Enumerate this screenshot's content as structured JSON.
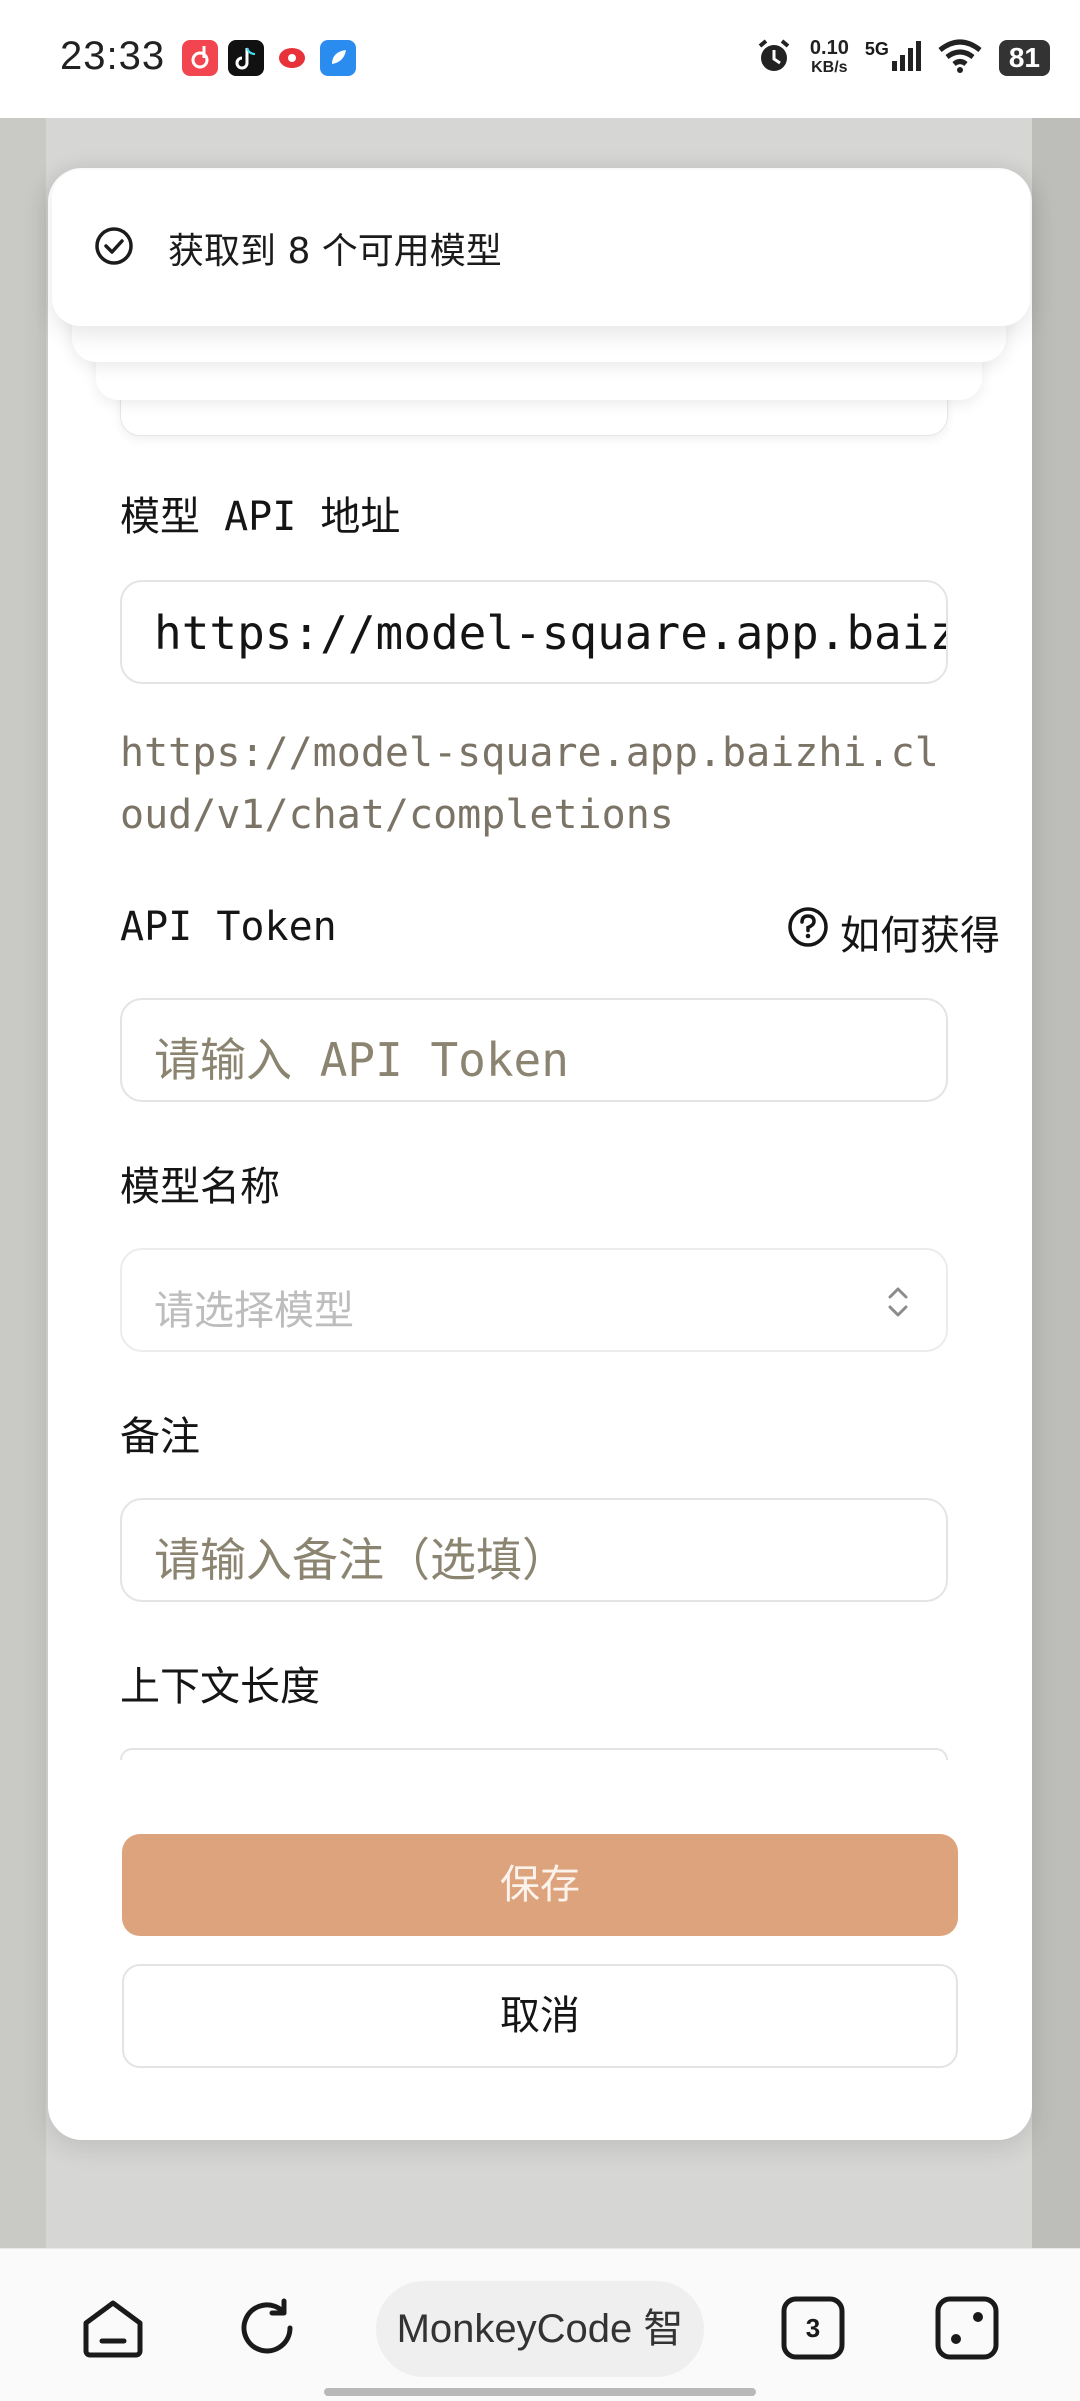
{
  "status_bar": {
    "time": "23:33",
    "net_speed_value": "0.10",
    "net_speed_unit": "KB/s",
    "signal": "5G",
    "battery": "81",
    "apps": [
      {
        "name": "app-red-icon",
        "color": "#f2454f"
      },
      {
        "name": "tiktok-icon",
        "color": "#111111"
      },
      {
        "name": "app-red-play-icon",
        "color": "#e8323a"
      },
      {
        "name": "app-blue-icon",
        "color": "#2b8cf0"
      }
    ]
  },
  "toast": {
    "message": "获取到 8 个可用模型",
    "icon": "check-circle-icon"
  },
  "form": {
    "api_url": {
      "label": "模型 API 地址",
      "value": "https://model-square.app.baizhi.cloud/v1",
      "hint": "https://model-square.app.baizhi.cloud/v1/chat/completions"
    },
    "api_token": {
      "label": "API Token",
      "help_label": "如何获得",
      "help_icon": "question-circle-icon",
      "placeholder": "请输入 API Token"
    },
    "model_name": {
      "label": "模型名称",
      "placeholder": "请选择模型",
      "icon": "chevron-up-down-icon"
    },
    "note": {
      "label": "备注",
      "placeholder": "请输入备注（选填）"
    },
    "context_length": {
      "label": "上下文长度"
    }
  },
  "buttons": {
    "save": "保存",
    "cancel": "取消"
  },
  "nav": {
    "center_label": "MonkeyCode 智",
    "tabs_count": "3",
    "icons": [
      "home-icon",
      "refresh-icon",
      "tabs-icon",
      "menu-icon"
    ]
  },
  "colors": {
    "save_button": "#dda37d",
    "hint_text": "#7b7466",
    "placeholder": "#8a8470"
  }
}
